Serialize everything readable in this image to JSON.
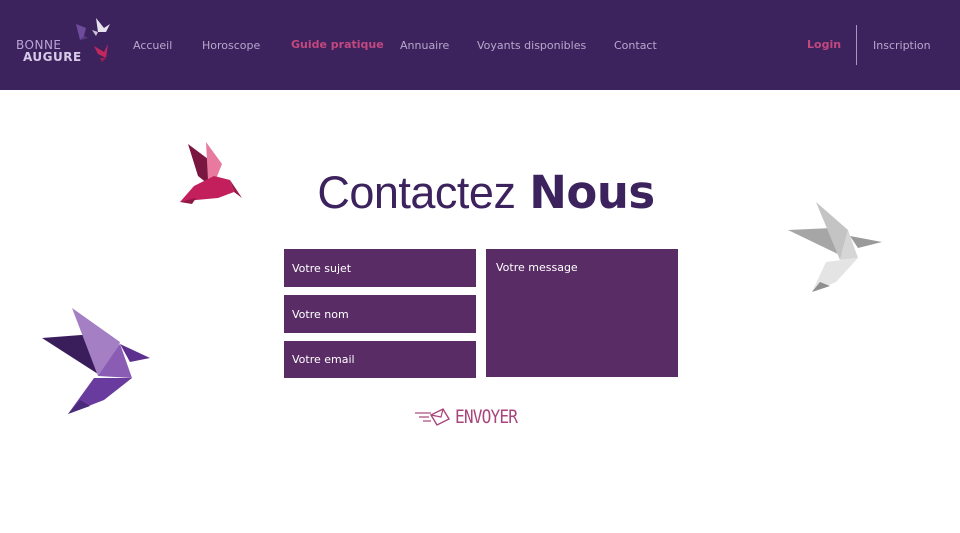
{
  "brand": {
    "line1": "BONNE",
    "line2": "AUGURE"
  },
  "nav": {
    "items": [
      {
        "label": "Accueil"
      },
      {
        "label": "Horoscope"
      },
      {
        "label": "Guide pratique"
      },
      {
        "label": "Annuaire"
      },
      {
        "label": "Voyants disponibles"
      },
      {
        "label": "Contact"
      }
    ],
    "active_index": 2,
    "login": "Login",
    "signup": "Inscription"
  },
  "title": {
    "light": "Contactez",
    "bold": "Nous"
  },
  "form": {
    "subject_placeholder": "Votre sujet",
    "name_placeholder": "Votre nom",
    "email_placeholder": "Votre email",
    "message_placeholder": "Votre message",
    "send_label": "ENVOYER"
  },
  "colors": {
    "header_bg": "#3d235e",
    "accent": "#c2487f",
    "field_bg": "#5a2c66",
    "title": "#3d235e"
  },
  "icons": [
    "origami-bird-logo-icon",
    "send-envelope-icon",
    "origami-bird-pink-icon",
    "origami-bird-purple-icon",
    "origami-bird-grey-icon"
  ]
}
